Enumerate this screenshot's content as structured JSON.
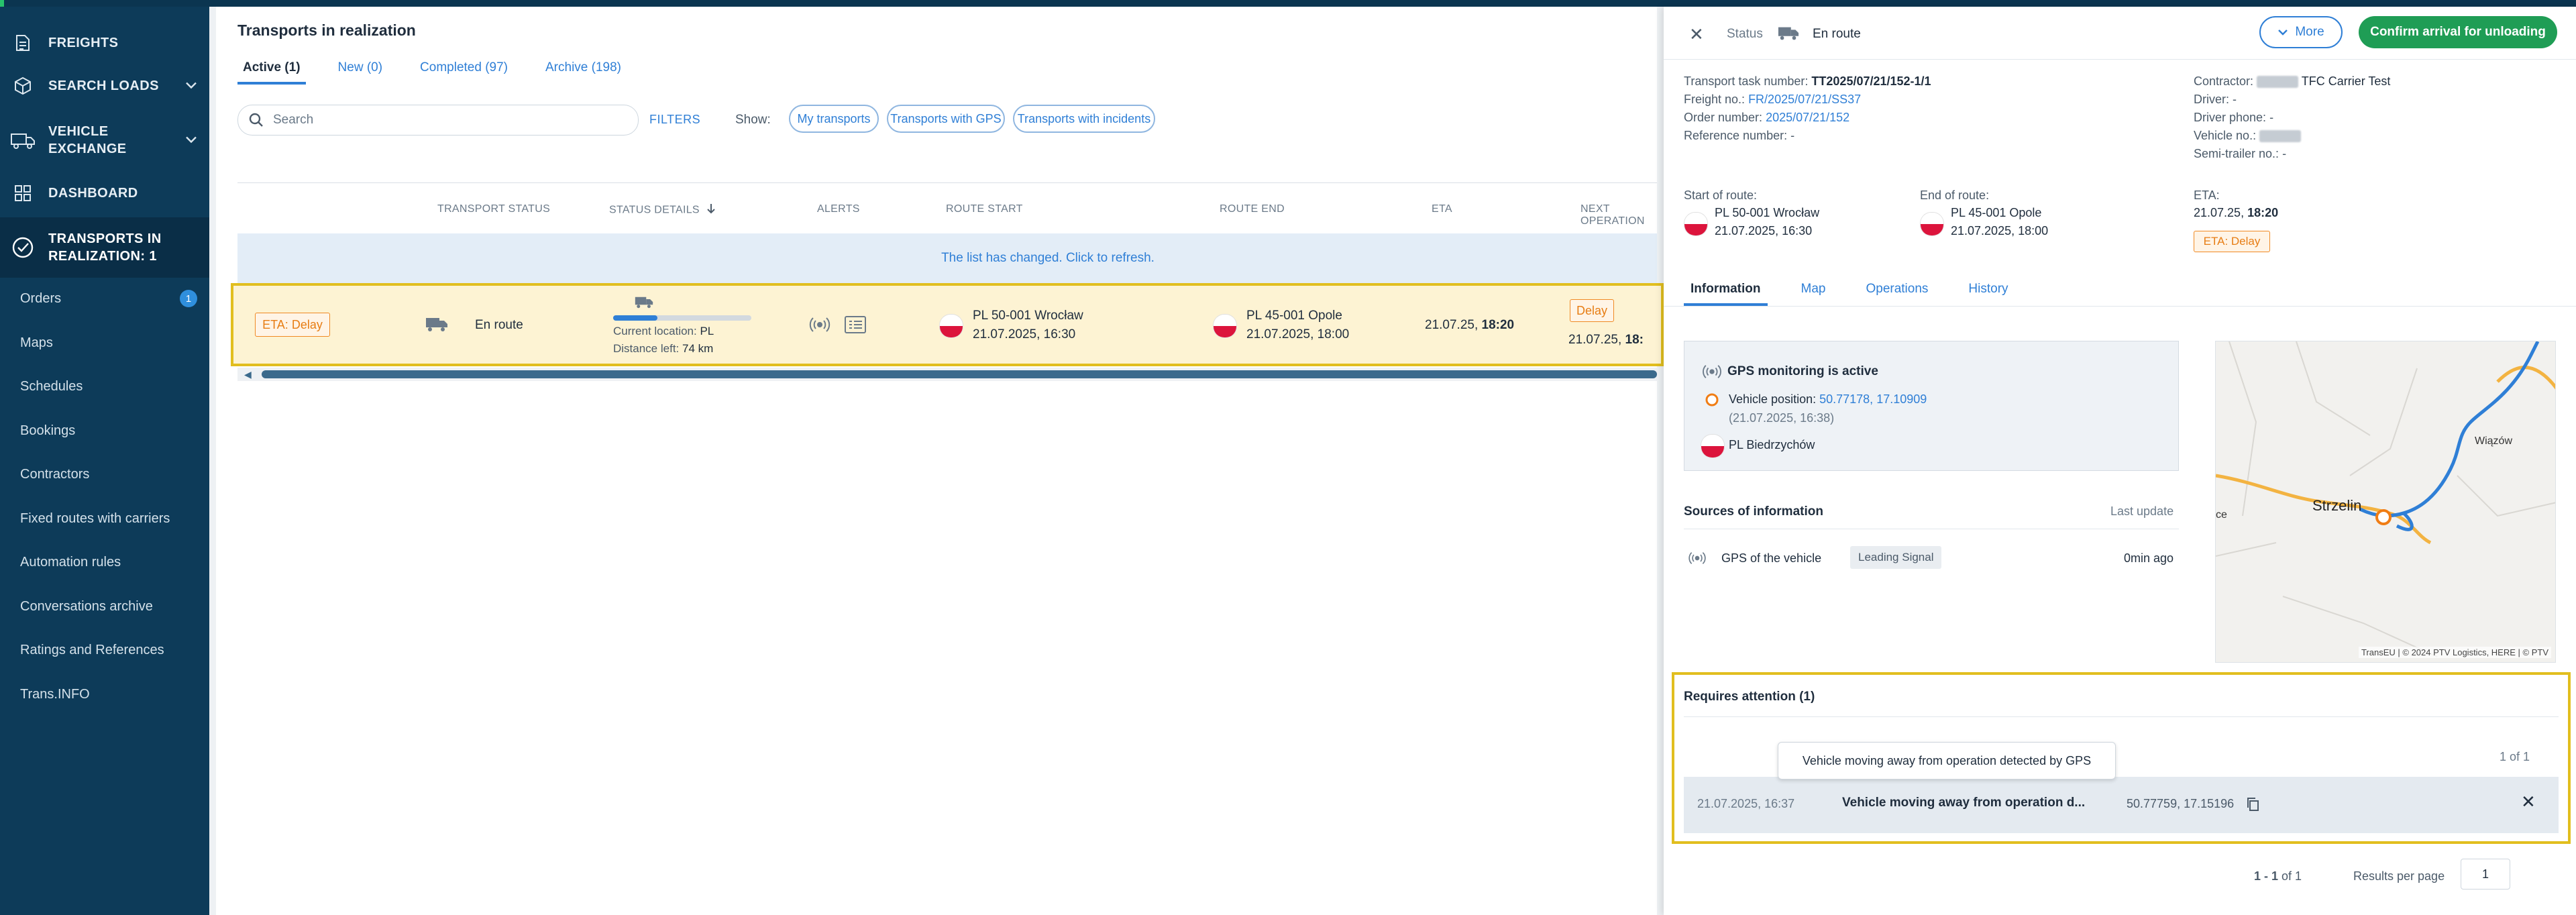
{
  "sidebar": {
    "main_items": [
      {
        "label": "FREIGHTS"
      },
      {
        "label": "SEARCH LOADS"
      },
      {
        "label": "VEHICLE EXCHANGE"
      },
      {
        "label": "DASHBOARD"
      },
      {
        "label": "TRANSPORTS IN REALIZATION: 1"
      }
    ],
    "sub_items": [
      {
        "label": "Orders",
        "badge": "1"
      },
      {
        "label": "Maps"
      },
      {
        "label": "Schedules"
      },
      {
        "label": "Bookings"
      },
      {
        "label": "Contractors"
      },
      {
        "label": "Fixed routes with carriers"
      },
      {
        "label": "Automation rules"
      },
      {
        "label": "Conversations archive"
      },
      {
        "label": "Ratings and References"
      },
      {
        "label": "Trans.INFO"
      }
    ]
  },
  "main": {
    "title": "Transports in realization",
    "tabs": [
      {
        "label": "Active (1)"
      },
      {
        "label": "New (0)"
      },
      {
        "label": "Completed (97)"
      },
      {
        "label": "Archive (198)"
      }
    ],
    "search_placeholder": "Search",
    "filters_label": "FILTERS",
    "show_label": "Show:",
    "chips": [
      "My transports",
      "Transports with GPS",
      "Transports with incidents"
    ],
    "columns": [
      "TRANSPORT STATUS",
      "STATUS DETAILS",
      "ALERTS",
      "ROUTE START",
      "ROUTE END",
      "ETA",
      "NEXT OPERATION"
    ],
    "list_changed": "The list has changed. Click to refresh.",
    "row": {
      "eta_badge": "ETA: Delay",
      "status": "En route",
      "progress": 0.32,
      "current_location_label": "Current location:",
      "current_location_value": "PL",
      "distance_label": "Distance left:",
      "distance_value": "74 km",
      "start_place": "PL 50-001 Wrocław",
      "start_time": "21.07.2025, 16:30",
      "end_place": "PL 45-001 Opole",
      "end_time": "21.07.2025, 18:00",
      "eta_date": "21.07.25,",
      "eta_time": "18:20",
      "next_badge": "Delay",
      "next_date": "21.07.25,",
      "next_time": "18:"
    }
  },
  "panel": {
    "status_label": "Status",
    "status_value": "En route",
    "more_label": "More",
    "confirm_label": "Confirm arrival for unloading",
    "task_number_label": "Transport task number:",
    "task_number": "TT2025/07/21/152-1/1",
    "freight_label": "Freight no.:",
    "freight_no": "FR/2025/07/21/SS37",
    "order_label": "Order number:",
    "order_no": "2025/07/21/152",
    "reference_label": "Reference number:",
    "reference_no": "-",
    "contractor_label": "Contractor:",
    "contractor_value": "TFC Carrier Test",
    "driver_label": "Driver:",
    "driver_value": "-",
    "driver_phone_label": "Driver phone:",
    "driver_phone_value": "-",
    "vehicle_label": "Vehicle no.:",
    "semi_trailer_label": "Semi-trailer no.:",
    "semi_trailer_value": "-",
    "start_label": "Start of route:",
    "start_place": "PL 50-001 Wrocław",
    "start_time": "21.07.2025, 16:30",
    "end_label": "End of route:",
    "end_place": "PL 45-001 Opole",
    "end_time": "21.07.2025, 18:00",
    "eta_label": "ETA:",
    "eta_date": "21.07.25,",
    "eta_time": "18:20",
    "eta_badge": "ETA: Delay",
    "tabs": [
      "Information",
      "Map",
      "Operations",
      "History"
    ],
    "gps_title": "GPS monitoring is active",
    "vehicle_position_label": "Vehicle position:",
    "vehicle_position": "50.77178, 17.10909",
    "vehicle_position_time": "(21.07.2025, 16:38)",
    "vehicle_place": "PL Biedrzychów",
    "sources_title": "Sources of information",
    "last_update_label": "Last update",
    "source_name": "GPS of the vehicle",
    "source_tag": "Leading Signal",
    "source_update": "0min ago",
    "map": {
      "label_1": "Wiązów",
      "label_2": "Strzelin",
      "label_3": "ce",
      "copyright": "TransEU | © 2024 PTV Logistics, HERE | © PTV"
    },
    "attention_title": "Requires attention (1)",
    "attention_count": "1 of 1",
    "tooltip": "Vehicle moving away from operation detected by GPS",
    "alert_time": "21.07.2025, 16:37",
    "alert_text": "Vehicle moving away from operation d...",
    "alert_coords": "50.77759, 17.15196",
    "pager_range_a": "1 - 1",
    "pager_range_b": "of 1",
    "rpp_label": "Results per page",
    "rpp_value": "1"
  },
  "colors": {
    "sidebar": "#0d3b59",
    "accent": "#2f7fd6",
    "confirm": "#1f9d55",
    "highlight": "#e1be1f",
    "delay": "#e77d14"
  }
}
